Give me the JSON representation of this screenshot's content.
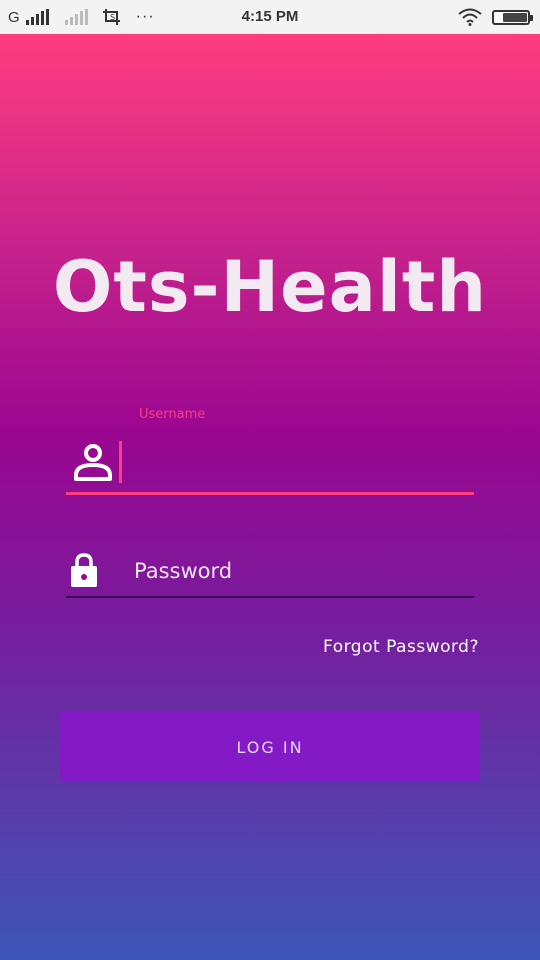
{
  "status_bar": {
    "carrier": "G",
    "time": "4:15 PM",
    "more": "···",
    "icons": [
      "signal-icon",
      "signal-weak-icon",
      "screenshot-icon",
      "wifi-icon",
      "battery-icon"
    ],
    "battery_level": 0.75
  },
  "app": {
    "logo": "Ots-Health"
  },
  "login_form": {
    "username_label": "Username",
    "username_value": "",
    "password_placeholder": "Password",
    "forgot_password": "Forgot Password?",
    "login_button": "LOG IN"
  },
  "colors": {
    "accent": "#ff3d7f",
    "button": "#8419c6",
    "gradient_top": "#ff3d7f",
    "gradient_mid": "#9b0790",
    "gradient_bottom": "#3c55b6"
  }
}
